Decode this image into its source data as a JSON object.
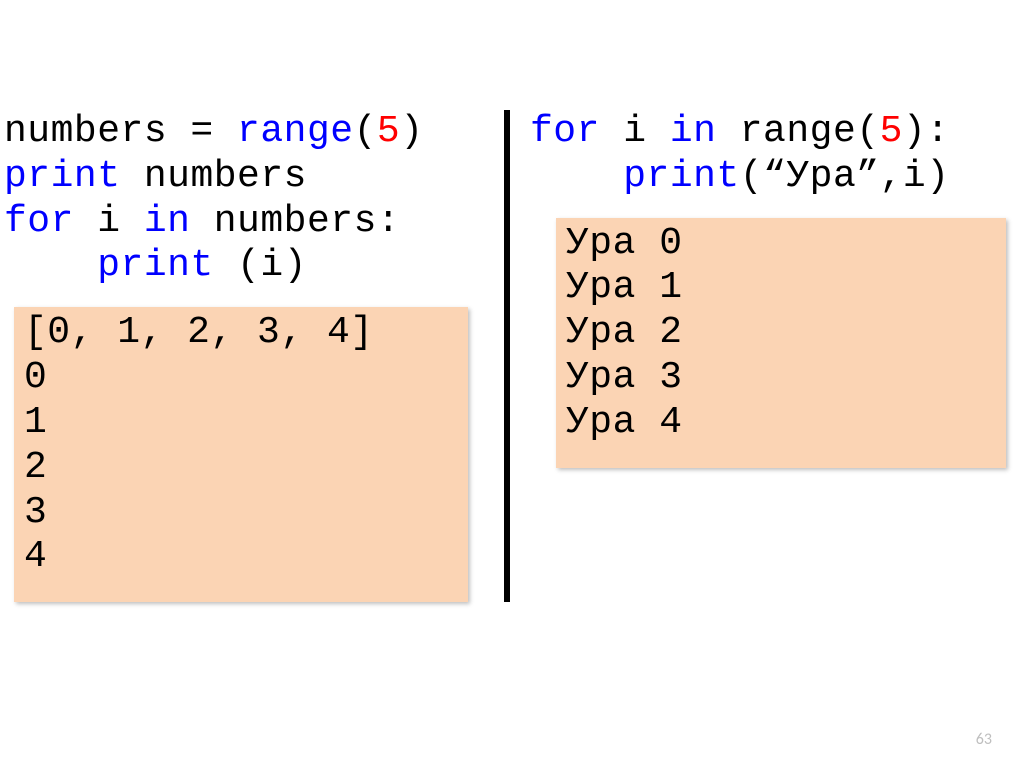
{
  "left": {
    "code": {
      "l1a": "numbers = ",
      "l1b": "range",
      "l1c": "(",
      "l1d": "5",
      "l1e": ")",
      "l2a": "print",
      "l2b": " numbers",
      "l3a": "for",
      "l3b": " i ",
      "l3c": "in",
      "l3d": " numbers:",
      "l4a": "    ",
      "l4b": "print",
      "l4c": " (i)"
    },
    "output": "[0, 1, 2, 3, 4]\n0\n1\n2\n3\n4"
  },
  "right": {
    "code": {
      "l1a": "for",
      "l1b": " i ",
      "l1c": "in",
      "l1d": " range(",
      "l1e": "5",
      "l1f": "):",
      "l2a": "    ",
      "l2b": "print",
      "l2c": "(",
      "l2d": "“Ура”",
      "l2e": ",i)"
    },
    "output": "Ура 0\nУра 1\nУра 2\nУра 3\nУра 4"
  },
  "page_number": "63"
}
